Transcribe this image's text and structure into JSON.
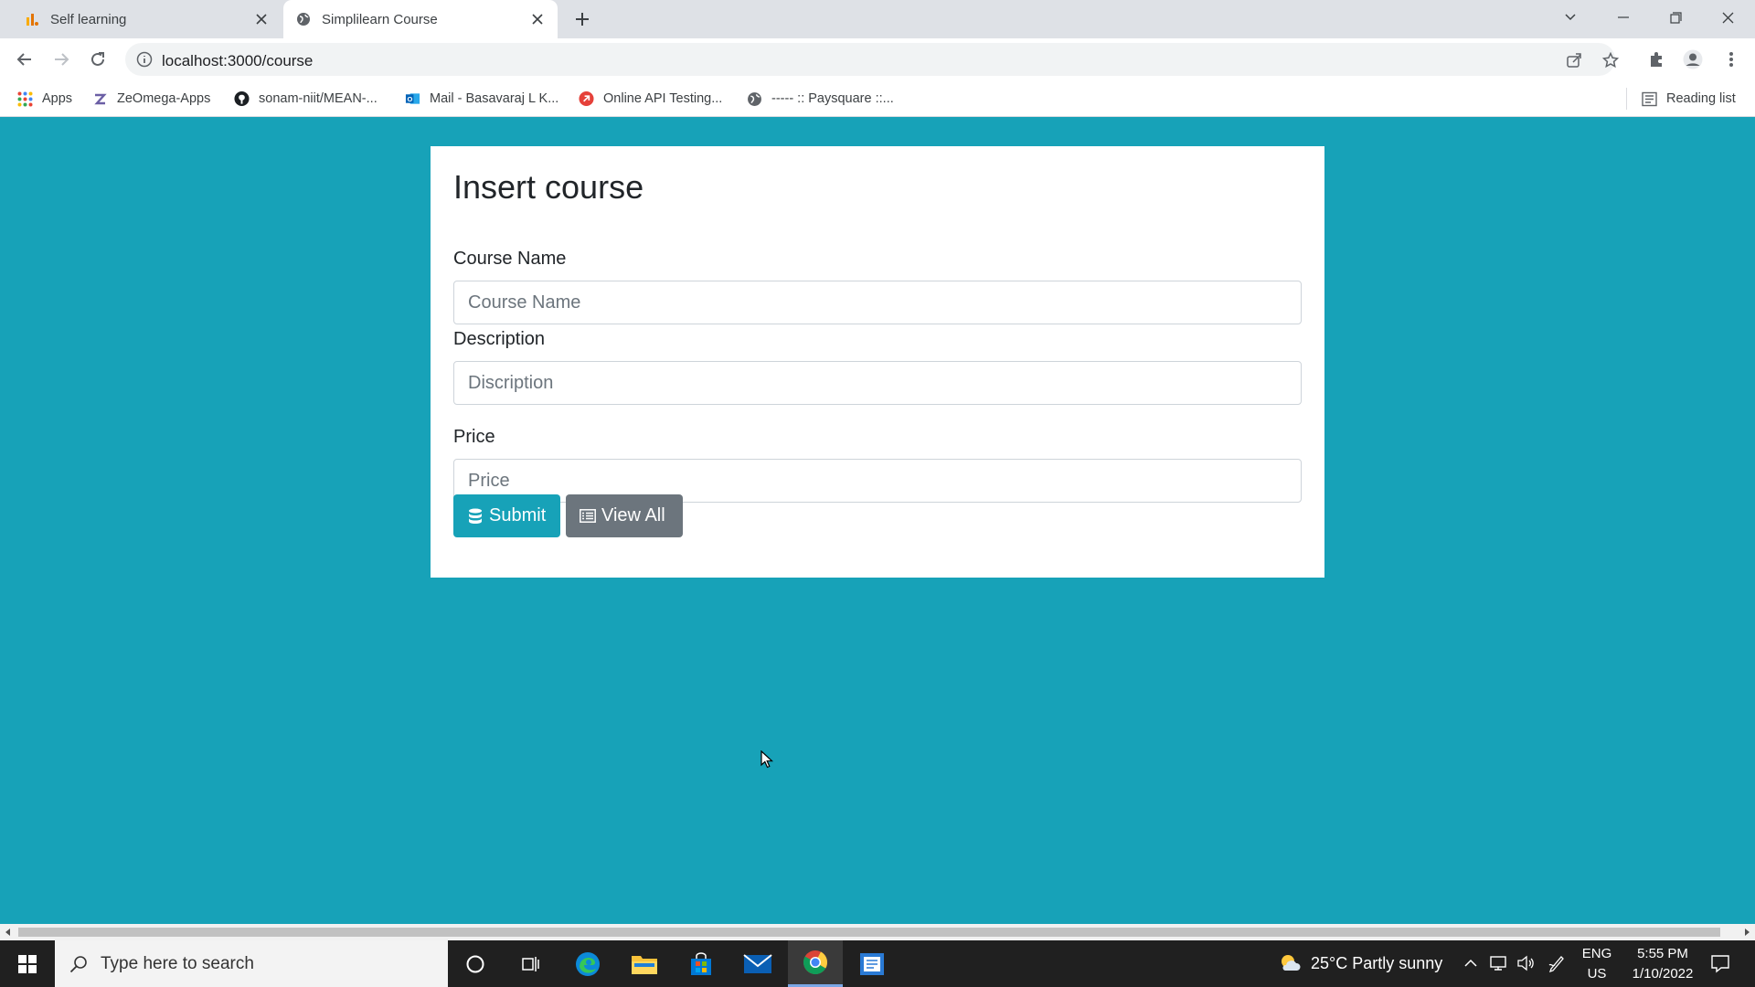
{
  "browser": {
    "tabs": [
      {
        "title": "Self learning",
        "favicon": "analytics-icon",
        "active": false
      },
      {
        "title": "Simplilearn Course",
        "favicon": "globe-icon",
        "active": true
      }
    ],
    "address": "localhost:3000/course",
    "bookmarks": [
      {
        "label": "Apps",
        "icon": "apps-grid-icon"
      },
      {
        "label": "ZeOmega-Apps",
        "icon": "zeomega-icon"
      },
      {
        "label": "sonam-niit/MEAN-...",
        "icon": "github-icon"
      },
      {
        "label": "Mail - Basavaraj L K...",
        "icon": "outlook-icon"
      },
      {
        "label": "Online API Testing...",
        "icon": "api-testing-icon"
      },
      {
        "label": "----- :: Paysquare ::...",
        "icon": "globe-icon"
      }
    ],
    "reading_list": "Reading list"
  },
  "form": {
    "title": "Insert course",
    "course_name": {
      "label": "Course Name",
      "placeholder": "Course Name",
      "value": ""
    },
    "description": {
      "label": "Description",
      "placeholder": "Discription",
      "value": ""
    },
    "price": {
      "label": "Price",
      "placeholder": "Price",
      "value": ""
    },
    "submit_label": "Submit",
    "view_all_label": "View All"
  },
  "colors": {
    "page_background": "#17a2b8",
    "submit_button": "#17a2b8",
    "view_all_button": "#6c757d"
  },
  "taskbar": {
    "search_placeholder": "Type here to search",
    "weather": "25°C  Partly sunny",
    "language": "ENG",
    "region": "US",
    "time": "5:55 PM",
    "date": "1/10/2022"
  }
}
